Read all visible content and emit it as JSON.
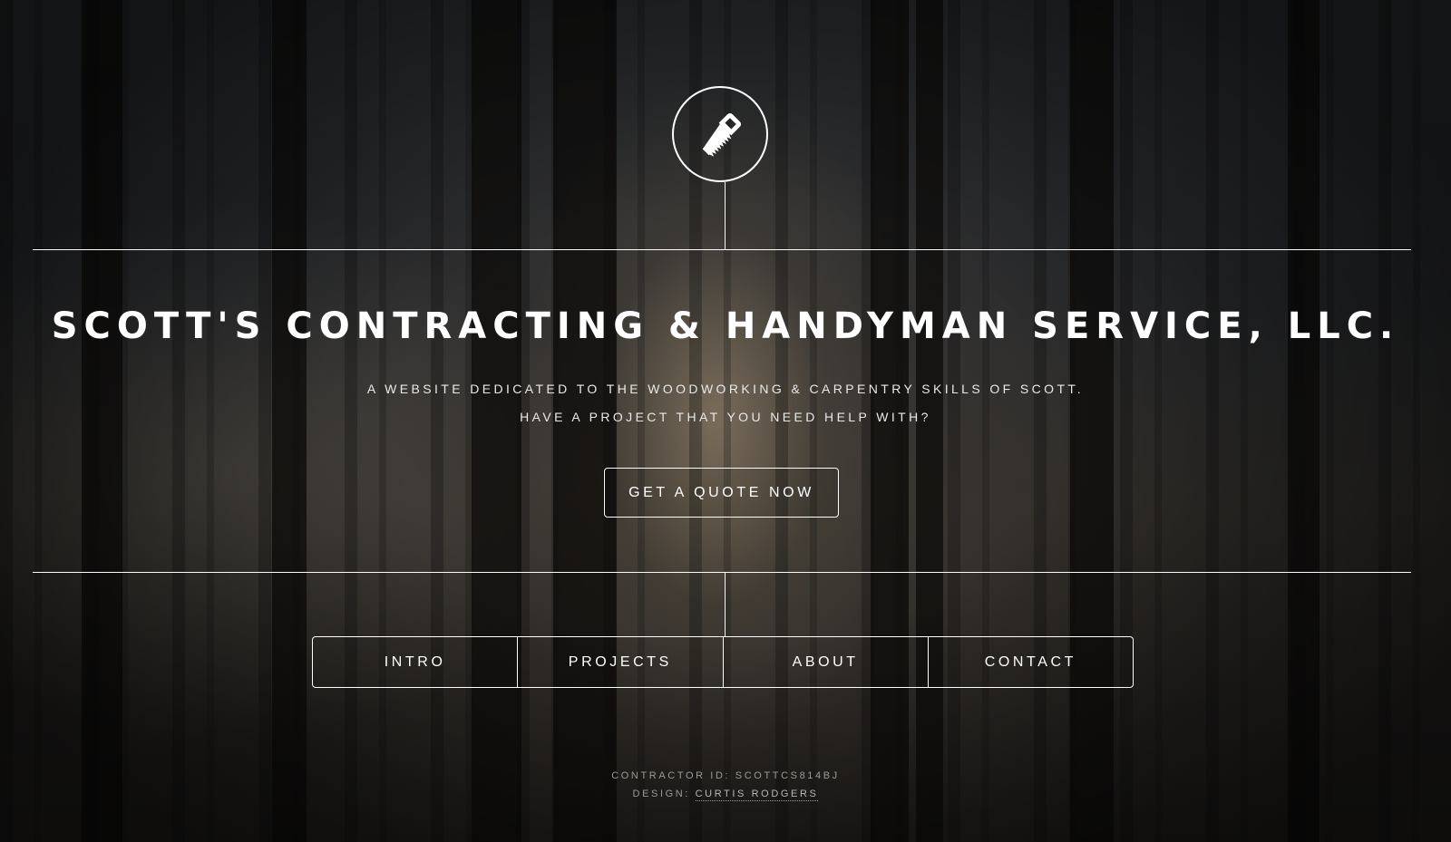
{
  "header": {
    "logo_icon": "saw-icon",
    "title": "SCOTT'S CONTRACTING & HANDYMAN SERVICE, LLC.",
    "tagline_line1": "A WEBSITE DEDICATED TO THE WOODWORKING & CARPENTRY SKILLS OF SCOTT.",
    "tagline_line2": "HAVE A PROJECT THAT YOU NEED HELP WITH?",
    "cta_label": "GET A QUOTE NOW"
  },
  "nav": {
    "items": [
      {
        "label": "INTRO"
      },
      {
        "label": "PROJECTS"
      },
      {
        "label": "ABOUT"
      },
      {
        "label": "CONTACT"
      }
    ]
  },
  "footer": {
    "contractor_id": "CONTRACTOR ID: SCOTTCS814BJ",
    "design_prefix": "DESIGN:",
    "design_link": "CURTIS RODGERS"
  },
  "colors": {
    "foreground": "#ffffff",
    "footer_text": "#9a9a9a"
  }
}
